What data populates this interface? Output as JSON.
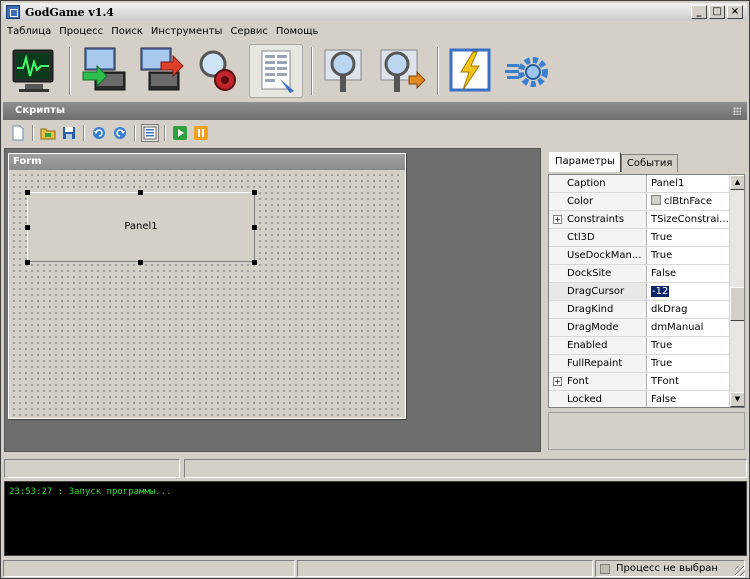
{
  "window": {
    "title": "GodGame v1.4"
  },
  "menu": [
    "Таблица",
    "Процесс",
    "Поиск",
    "Инструменты",
    "Сервис",
    "Помощь"
  ],
  "toolbar_icons": [
    "monitor-pulse-icon",
    "monitor-import-icon",
    "monitor-export-icon",
    "search-tools-icon",
    "script-editor-icon",
    "magnifier-icon",
    "magnifier-next-icon",
    "lightning-icon",
    "gear-icon"
  ],
  "scripts_header": "Скрипты",
  "script_toolbar_icons": [
    "new-icon",
    "open-icon",
    "save-icon",
    "undo-icon",
    "redo-icon",
    "properties-icon",
    "run-icon",
    "pause-icon"
  ],
  "form_designer": {
    "form_caption": "Form",
    "panel_caption": "Panel1"
  },
  "inspector": {
    "tabs": [
      "Параметры",
      "События"
    ],
    "properties": [
      {
        "name": "Caption",
        "value": "Panel1"
      },
      {
        "name": "Color",
        "value": "clBtnFace",
        "swatch": "#d4d0c8"
      },
      {
        "name": "Constraints",
        "value": "TSizeConstrai...",
        "expandable": true
      },
      {
        "name": "Ctl3D",
        "value": "True"
      },
      {
        "name": "UseDockMan...",
        "value": "True"
      },
      {
        "name": "DockSite",
        "value": "False"
      },
      {
        "name": "DragCursor",
        "value": "-12",
        "selected": true
      },
      {
        "name": "DragKind",
        "value": "dkDrag"
      },
      {
        "name": "DragMode",
        "value": "dmManual"
      },
      {
        "name": "Enabled",
        "value": "True"
      },
      {
        "name": "FullRepaint",
        "value": "True"
      },
      {
        "name": "Font",
        "value": "TFont",
        "expandable": true
      },
      {
        "name": "Locked",
        "value": "False"
      }
    ]
  },
  "console": {
    "lines": [
      "23:53:27 : Запуск программы..."
    ],
    "text_color": "#33dd33"
  },
  "statusbar": {
    "process": "Процесс не выбран"
  }
}
